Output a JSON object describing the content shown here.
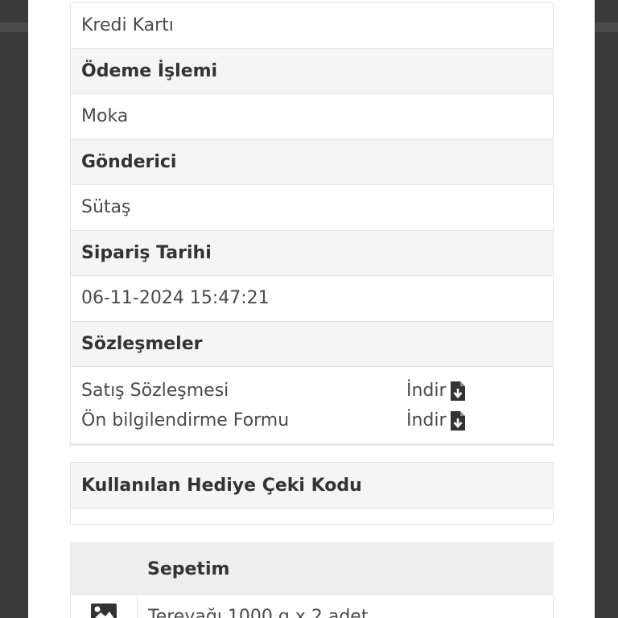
{
  "details": [
    {
      "kind": "value",
      "text": "Kredi Kartı"
    },
    {
      "kind": "head",
      "text": "Ödeme İşlemi"
    },
    {
      "kind": "value",
      "text": "Moka"
    },
    {
      "kind": "head",
      "text": "Gönderici"
    },
    {
      "kind": "value",
      "text": "Sütaş"
    },
    {
      "kind": "head",
      "text": "Sipariş Tarihi"
    },
    {
      "kind": "value",
      "text": "06-11-2024 15:47:21"
    },
    {
      "kind": "head",
      "text": "Sözleşmeler"
    }
  ],
  "contracts": [
    {
      "name": "Satış Sözleşmesi",
      "action": "İndir"
    },
    {
      "name": "Ön bilgilendirme Formu",
      "action": "İndir"
    }
  ],
  "gift": {
    "title": "Kullanılan Hediye Çeki Kodu"
  },
  "cart": {
    "title": "Sepetim",
    "items": [
      {
        "name": "Tereyağı 1000 g x 2 adet",
        "icon": "image-icon"
      }
    ]
  },
  "icons": {
    "download": "download-file-icon"
  },
  "colors": {
    "header_bg": "#f5f5f5",
    "border": "#e3e3e3",
    "backdrop": "#3a3a3a"
  }
}
